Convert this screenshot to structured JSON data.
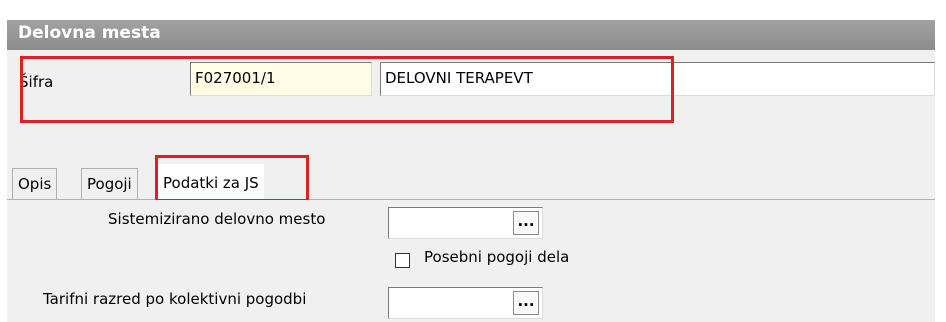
{
  "window": {
    "title": "Delovna mesta"
  },
  "header": {
    "code_label": "Šifra",
    "code_value": "F027001/1",
    "name_value": "DELOVNI TERAPEVT"
  },
  "tabs": [
    {
      "label": "Opis",
      "active": false
    },
    {
      "label": "Pogoji",
      "active": false
    },
    {
      "label": "Podatki za JS",
      "active": true
    }
  ],
  "form": {
    "systemized_label": "Sistemizirano delovno mesto",
    "systemized_value": "",
    "systemized_button": "...",
    "special_conditions_label": "Posebni pogoji dela",
    "special_conditions_checked": false,
    "tariff_label": "Tarifni razred po kolektivni pogodbi",
    "tariff_value": "",
    "tariff_button": "..."
  },
  "colors": {
    "highlight": "#e02020",
    "title_bar": "#9a9a9a",
    "code_field_bg": "#fffde6"
  }
}
